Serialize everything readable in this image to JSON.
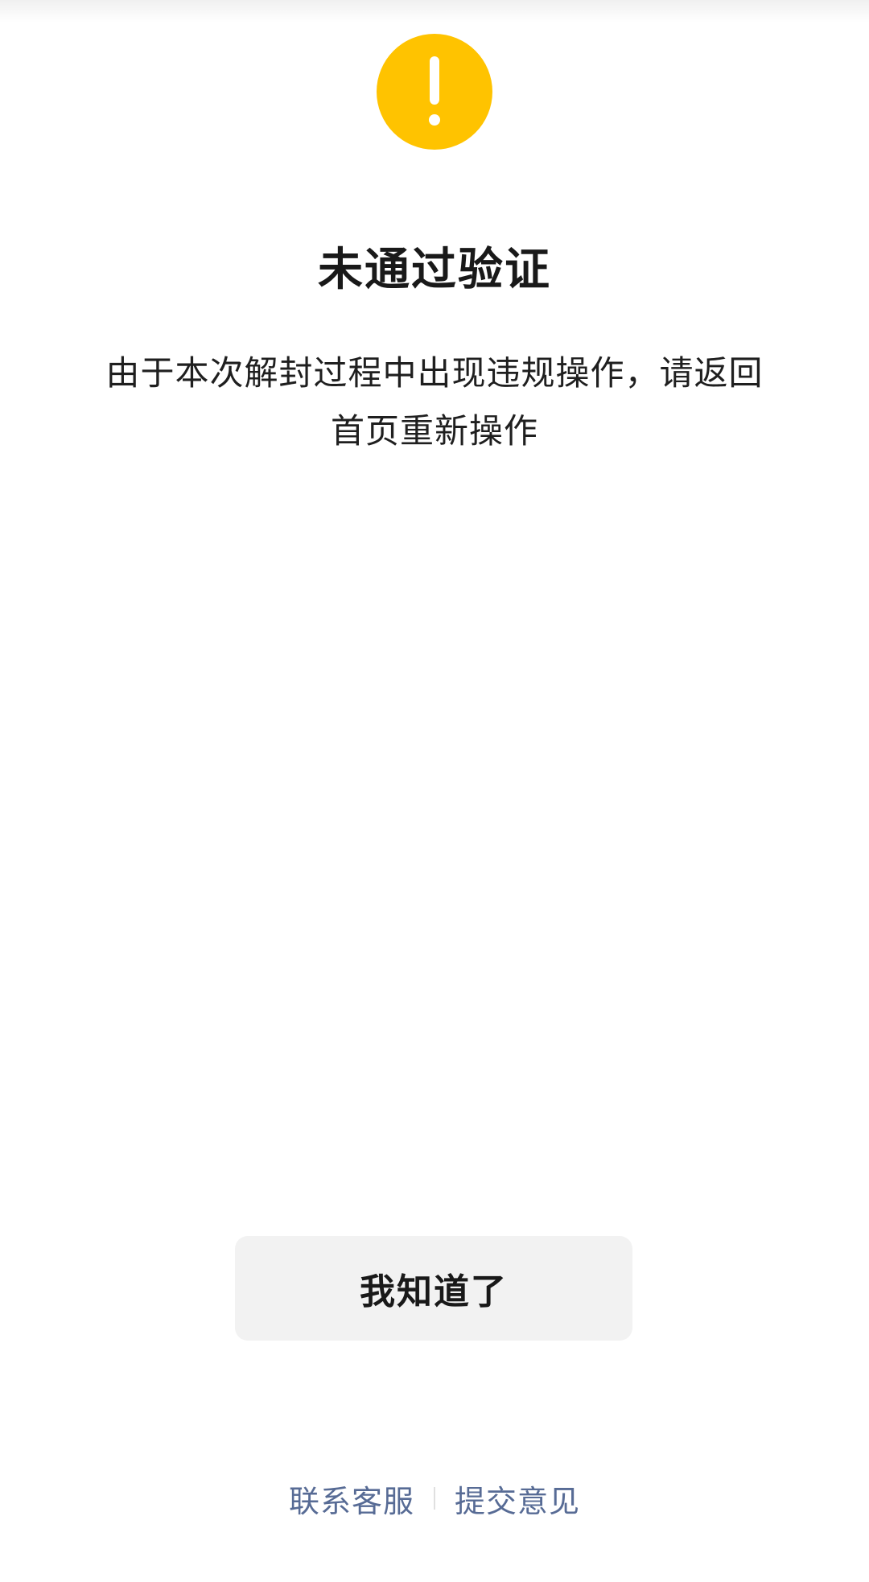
{
  "colors": {
    "warning": "#FFC300",
    "link": "#576B95",
    "button_bg": "#F2F2F2"
  },
  "icon": "warning-exclamation-icon",
  "title": "未通过验证",
  "description": {
    "line1": "由于本次解封过程中出现违规操作，请返回",
    "line2": "首页重新操作"
  },
  "confirm_button": {
    "label": "我知道了"
  },
  "footer": {
    "contact_label": "联系客服",
    "feedback_label": "提交意见"
  }
}
